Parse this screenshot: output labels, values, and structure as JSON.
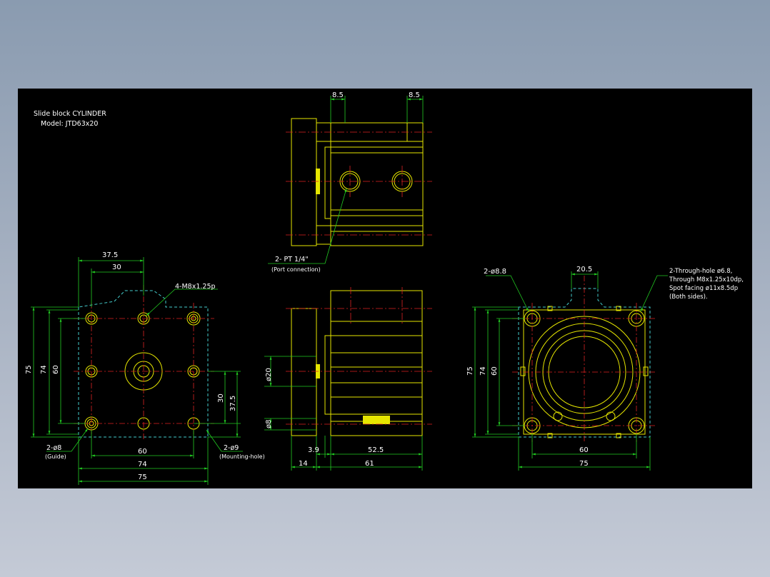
{
  "title": {
    "line1": "Slide block CYLINDER",
    "line2": "Model:  JTD63x20"
  },
  "colors": {
    "background": "#000000",
    "part": "#e6e600",
    "dimension": "#22cc22",
    "center": "#dd2222",
    "text": "#ffffff",
    "hidden": "#44cccc"
  },
  "top_view": {
    "dim_left": "8.5",
    "dim_right": "8.5",
    "port_label": "2-  PT 1/4\"",
    "port_note": "(Port connection)"
  },
  "left_view": {
    "dim_37_5_top": "37.5",
    "dim_30_top": "30",
    "thread_label": "4-M8x1.25p",
    "dim_75_left": "75",
    "dim_74_left": "74",
    "dim_60_left": "60",
    "dim_30_right": "30",
    "dim_37_5_right": "37.5",
    "guide_label": "2-ø8",
    "guide_note": "(Guide)",
    "mount_label": "2-ø9",
    "mount_note": "(Mounting-hole)",
    "dim_60_bottom": "60",
    "dim_74_bottom": "74",
    "dim_75_bottom": "75"
  },
  "side_view": {
    "dim_phi20": "ø20",
    "dim_phi8": "ø8",
    "dim_3_9": "3.9",
    "dim_52_5": "52.5",
    "dim_14": "14",
    "dim_61": "61"
  },
  "right_view": {
    "hole_label": "2-ø8.8",
    "dim_20_5": "20.5",
    "note_line1": "2-Through-hole ø6.8,",
    "note_line2": "Through M8x1.25x10dp,",
    "note_line3": "Spot facing ø11x8.5dp",
    "note_line4": "(Both sides).",
    "dim_75_left": "75",
    "dim_74_left": "74",
    "dim_60_left": "60",
    "dim_60_bottom": "60",
    "dim_75_bottom": "75"
  }
}
